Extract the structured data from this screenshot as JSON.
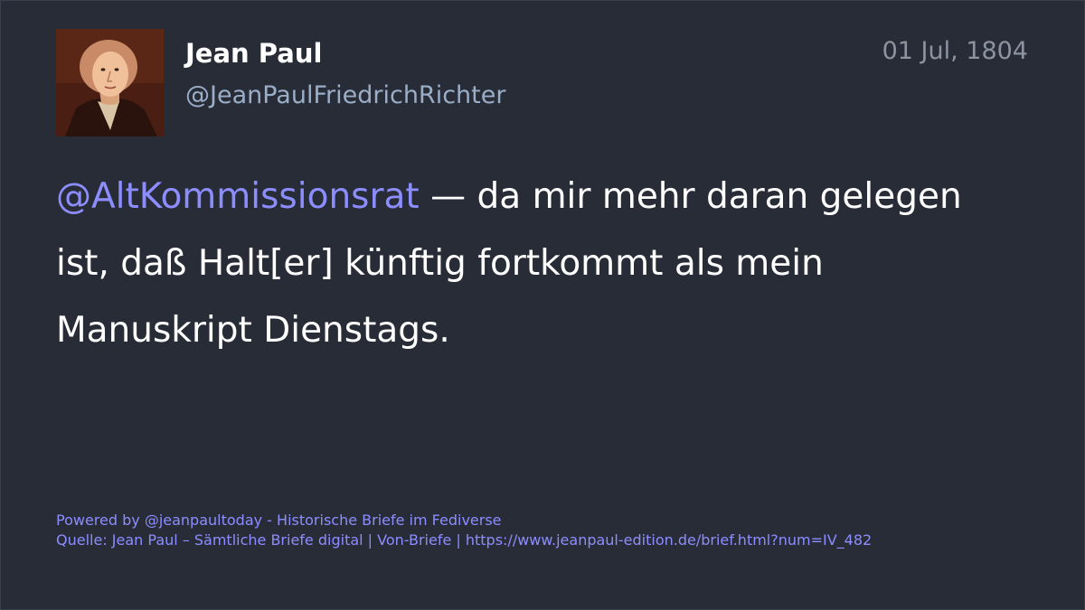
{
  "author": {
    "display_name": "Jean Paul",
    "handle": "@JeanPaulFriedrichRichter",
    "avatar_icon": "portrait-avatar"
  },
  "post": {
    "date": "01 Jul, 1804",
    "mention": "@AltKommissionsrat",
    "text": " — da mir mehr daran gelegen ist, daß Halt[er] künftig fortkommt als mein Manuskript Dienstags."
  },
  "footer": {
    "powered_by": "Powered by @jeanpaultoday - Historische Briefe im Fediverse",
    "source": "Quelle: Jean Paul – Sämtliche Briefe digital | Von-Briefe | https://www.jeanpaul-edition.de/brief.html?num=IV_482"
  },
  "colors": {
    "background": "#282c37",
    "mention": "#8c8dff",
    "handle": "#9baec8",
    "text": "#ffffff"
  }
}
